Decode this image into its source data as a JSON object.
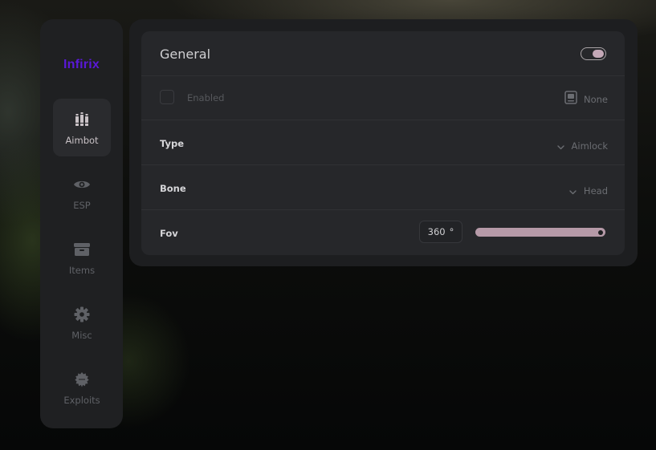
{
  "app": {
    "logo": "Infirix",
    "accent": "#5a18d8"
  },
  "sidebar": {
    "items": [
      {
        "label": "Aimbot",
        "icon": "bullets-icon",
        "active": true
      },
      {
        "label": "ESP",
        "icon": "eye-icon",
        "active": false
      },
      {
        "label": "Items",
        "icon": "box-icon",
        "active": false
      },
      {
        "label": "Misc",
        "icon": "gear-icon",
        "active": false
      },
      {
        "label": "Exploits",
        "icon": "bug-icon",
        "active": false
      }
    ]
  },
  "general": {
    "title": "General",
    "toggle_on": true,
    "enabled": {
      "label": "Enabled",
      "checked": false,
      "keybind": "None",
      "keybind_icon": "keybind-icon"
    },
    "type": {
      "label": "Type",
      "value": "Aimlock"
    },
    "bone": {
      "label": "Bone",
      "value": "Head"
    },
    "fov": {
      "label": "Fov",
      "value": "360",
      "unit": "°",
      "fraction": 1.0
    }
  },
  "colors": {
    "slider_fill": "#b69aa8",
    "toggle_knob": "#c4a8b7"
  }
}
